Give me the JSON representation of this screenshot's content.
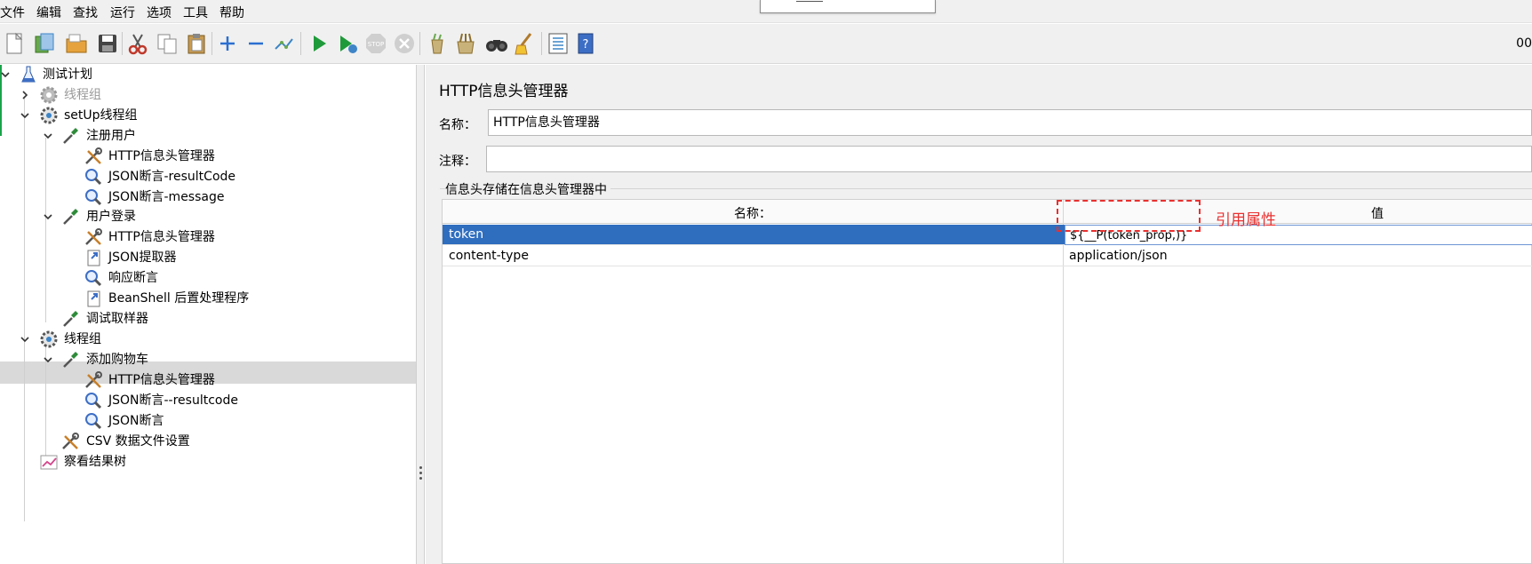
{
  "menu": [
    "文件",
    "编辑",
    "查找",
    "运行",
    "选项",
    "工具",
    "帮助"
  ],
  "toolbar": {
    "buttons": [
      "new-icon",
      "templates-icon",
      "open-icon",
      "save-icon",
      "cut-icon",
      "copy-icon",
      "paste-icon",
      "expand-icon",
      "collapse-icon",
      "toggle-icon",
      "start-icon",
      "start-no-pause-icon",
      "stop-icon",
      "shutdown-icon",
      "clear-icon",
      "clear-all-icon",
      "search-icon",
      "reset-search-icon",
      "function-helper-icon",
      "help-icon"
    ],
    "timer": "00"
  },
  "tree": {
    "root": "测试计划",
    "items": [
      {
        "label": "线程组",
        "disabled": true
      },
      {
        "label": "setUp线程组"
      },
      {
        "label": "注册用户"
      },
      {
        "label": "HTTP信息头管理器"
      },
      {
        "label": "JSON断言-resultCode"
      },
      {
        "label": "JSON断言-message"
      },
      {
        "label": "用户登录"
      },
      {
        "label": "HTTP信息头管理器"
      },
      {
        "label": "JSON提取器"
      },
      {
        "label": "响应断言"
      },
      {
        "label": "BeanShell 后置处理程序"
      },
      {
        "label": "调试取样器"
      },
      {
        "label": "线程组"
      },
      {
        "label": "添加购物车"
      },
      {
        "label": "HTTP信息头管理器"
      },
      {
        "label": "JSON断言--resultcode"
      },
      {
        "label": "JSON断言"
      },
      {
        "label": "CSV 数据文件设置"
      },
      {
        "label": "察看结果树"
      }
    ]
  },
  "panel": {
    "title": "HTTP信息头管理器",
    "name_label": "名称：",
    "name_value": "HTTP信息头管理器",
    "comment_label": "注释：",
    "comment_value": "",
    "group_label": "信息头存储在信息头管理器中",
    "table": {
      "columns": [
        "名称：",
        "值"
      ],
      "rows": [
        {
          "name": "token",
          "value": "${__P(token_prop,)}"
        },
        {
          "name": "content-type",
          "value": "application/json"
        }
      ]
    },
    "annotation": "引用属性"
  },
  "colors": {
    "selection": "#2f6dbf",
    "annotation": "#e8302f",
    "tree_selected": "#d9d9d9"
  }
}
